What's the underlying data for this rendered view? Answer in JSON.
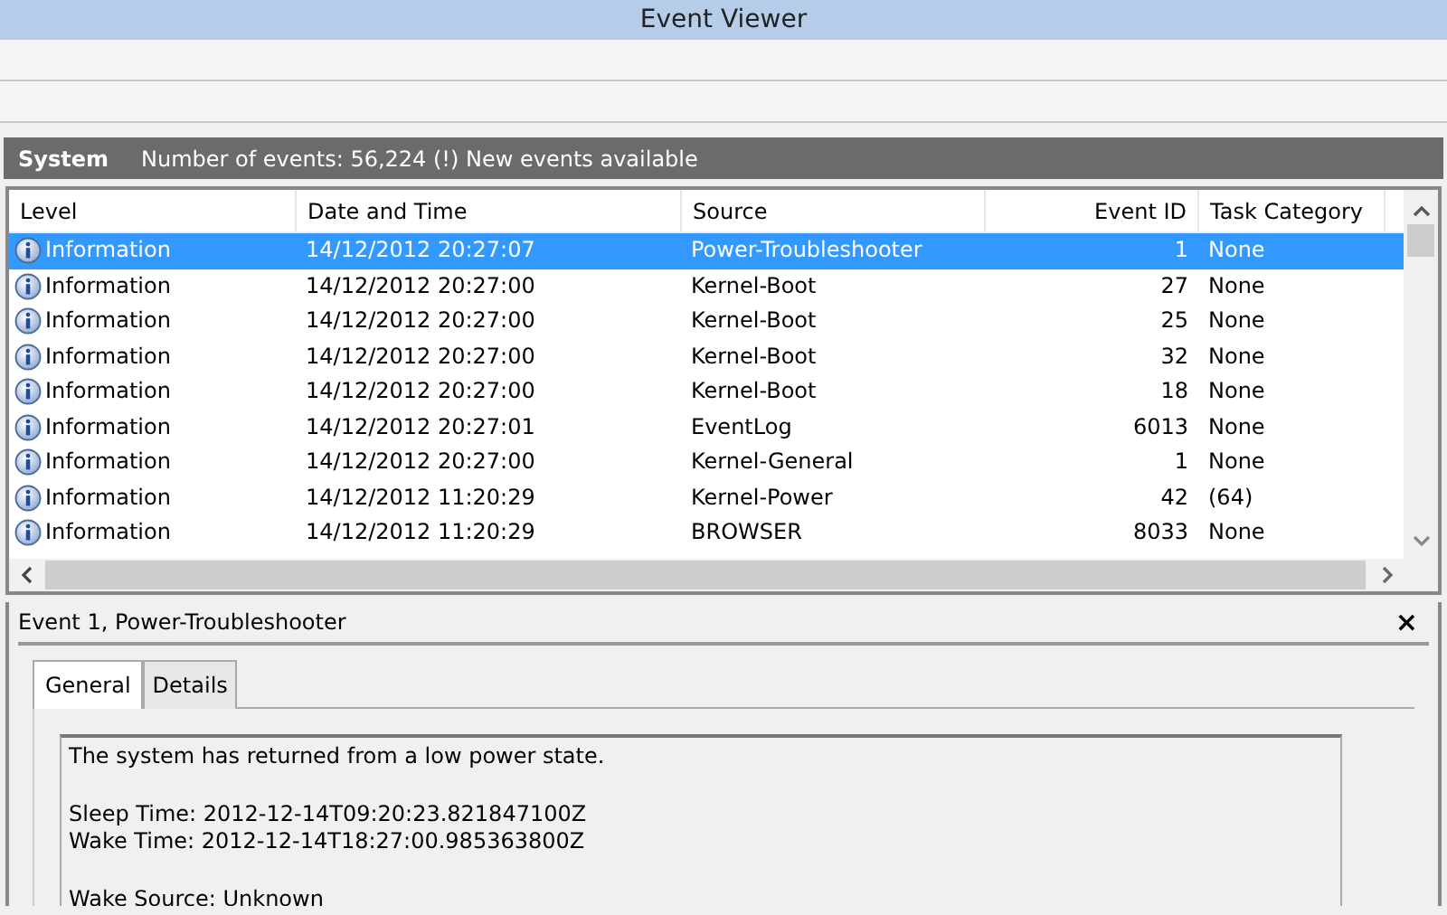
{
  "window": {
    "title": "Event Viewer"
  },
  "log_header": {
    "name": "System",
    "summary": "Number of events: 56,224 (!) New events available"
  },
  "table": {
    "columns": [
      "Level",
      "Date and Time",
      "Source",
      "Event ID",
      "Task Category"
    ],
    "rows": [
      {
        "level": "Information",
        "date": "14/12/2012 20:27:07",
        "source": "Power-Troubleshooter",
        "event_id": "1",
        "task_category": "None",
        "selected": true
      },
      {
        "level": "Information",
        "date": "14/12/2012 20:27:00",
        "source": "Kernel-Boot",
        "event_id": "27",
        "task_category": "None",
        "selected": false
      },
      {
        "level": "Information",
        "date": "14/12/2012 20:27:00",
        "source": "Kernel-Boot",
        "event_id": "25",
        "task_category": "None",
        "selected": false
      },
      {
        "level": "Information",
        "date": "14/12/2012 20:27:00",
        "source": "Kernel-Boot",
        "event_id": "32",
        "task_category": "None",
        "selected": false
      },
      {
        "level": "Information",
        "date": "14/12/2012 20:27:00",
        "source": "Kernel-Boot",
        "event_id": "18",
        "task_category": "None",
        "selected": false
      },
      {
        "level": "Information",
        "date": "14/12/2012 20:27:01",
        "source": "EventLog",
        "event_id": "6013",
        "task_category": "None",
        "selected": false
      },
      {
        "level": "Information",
        "date": "14/12/2012 20:27:00",
        "source": "Kernel-General",
        "event_id": "1",
        "task_category": "None",
        "selected": false
      },
      {
        "level": "Information",
        "date": "14/12/2012 11:20:29",
        "source": "Kernel-Power",
        "event_id": "42",
        "task_category": "(64)",
        "selected": false
      },
      {
        "level": "Information",
        "date": "14/12/2012 11:20:29",
        "source": "BROWSER",
        "event_id": "8033",
        "task_category": "None",
        "selected": false
      }
    ]
  },
  "details": {
    "title": "Event 1, Power-Troubleshooter",
    "close": "×",
    "tabs": [
      {
        "label": "General",
        "selected": true
      },
      {
        "label": "Details",
        "selected": false
      }
    ],
    "paragraphs": [
      [
        "The system has returned from a low power state."
      ],
      [
        "Sleep Time: 2012-12-14T09:20:23.821847100Z",
        "Wake Time: 2012-12-14T18:27:00.985363800Z"
      ],
      [
        "Wake Source: Unknown"
      ]
    ]
  }
}
